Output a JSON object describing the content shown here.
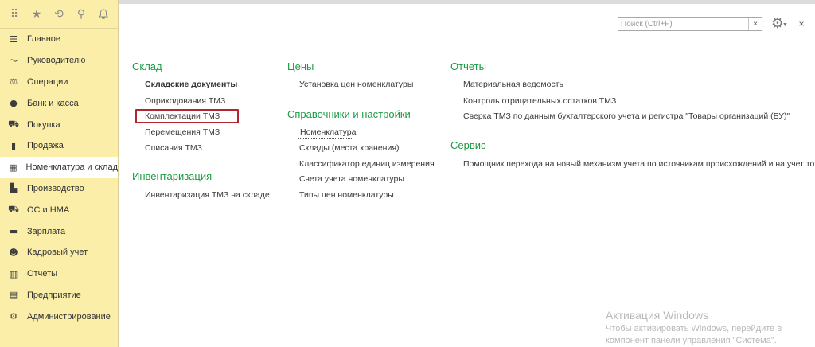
{
  "top_icons": [
    {
      "name": "apps-grid-icon",
      "glyph": "⠿"
    },
    {
      "name": "favorites-star-icon",
      "glyph": "★"
    },
    {
      "name": "history-icon",
      "glyph": "⟲"
    },
    {
      "name": "search-icon",
      "glyph": "⚲"
    },
    {
      "name": "notifications-bell-icon",
      "glyph": "🔔"
    }
  ],
  "sidebar": {
    "items": [
      {
        "label": "Главное",
        "icon": "menu-lines-icon",
        "glyph": "☰"
      },
      {
        "label": "Руководителю",
        "icon": "trend-chart-icon",
        "glyph": "〜"
      },
      {
        "label": "Операции",
        "icon": "operations-icon",
        "glyph": "⚖"
      },
      {
        "label": "Банк и касса",
        "icon": "bank-coin-icon",
        "glyph": "●"
      },
      {
        "label": "Покупка",
        "icon": "cart-icon",
        "glyph": "⛟"
      },
      {
        "label": "Продажа",
        "icon": "bag-icon",
        "glyph": "▮"
      },
      {
        "label": "Номенклатура и склад",
        "icon": "warehouse-grid-icon",
        "glyph": "▦"
      },
      {
        "label": "Производство",
        "icon": "factory-icon",
        "glyph": "▙"
      },
      {
        "label": "ОС и НМА",
        "icon": "truck-icon",
        "glyph": "⛟"
      },
      {
        "label": "Зарплата",
        "icon": "wallet-icon",
        "glyph": "▬"
      },
      {
        "label": "Кадровый учет",
        "icon": "people-icon",
        "glyph": "☻"
      },
      {
        "label": "Отчеты",
        "icon": "bar-chart-icon",
        "glyph": "▥"
      },
      {
        "label": "Предприятие",
        "icon": "building-icon",
        "glyph": "▤"
      },
      {
        "label": "Администрирование",
        "icon": "settings-gear-icon",
        "glyph": "⚙"
      }
    ],
    "active_index": 6
  },
  "search": {
    "placeholder": "Поиск (Ctrl+F)",
    "value": "",
    "clear_glyph": "×"
  },
  "gear_glyph": "⚙",
  "close_glyph": "×",
  "sections": {
    "sklad": {
      "title": "Склад",
      "group_header": "Складские документы",
      "links": [
        "Оприходования ТМЗ",
        "Комплектации ТМЗ",
        "Перемещения ТМЗ",
        "Списания ТМЗ"
      ]
    },
    "inventory": {
      "title": "Инвентаризация",
      "links": [
        "Инвентаризация ТМЗ на складе"
      ]
    },
    "prices": {
      "title": "Цены",
      "links": [
        "Установка цен номенклатуры"
      ]
    },
    "directories": {
      "title": "Справочники и настройки",
      "links": [
        "Номенклатура",
        "Склады (места хранения)",
        "Классификатор единиц измерения",
        "Счета учета номенклатуры",
        "Типы цен номенклатуры"
      ]
    },
    "reports": {
      "title": "Отчеты",
      "links": [
        "Материальная ведомость",
        "Контроль отрицательных остатков ТМЗ",
        "Сверка ТМЗ по данным бухгалтерского учета и регистра \"Товары организаций (БУ)\""
      ]
    },
    "service": {
      "title": "Сервис",
      "links": [
        "Помощник перехода на новый механизм учета по источникам происхождений и на учет товаров"
      ]
    }
  },
  "watermark": {
    "title": "Активация Windows",
    "line1": "Чтобы активировать Windows, перейдите в",
    "line2": "компонент панели управления \"Система\"."
  }
}
